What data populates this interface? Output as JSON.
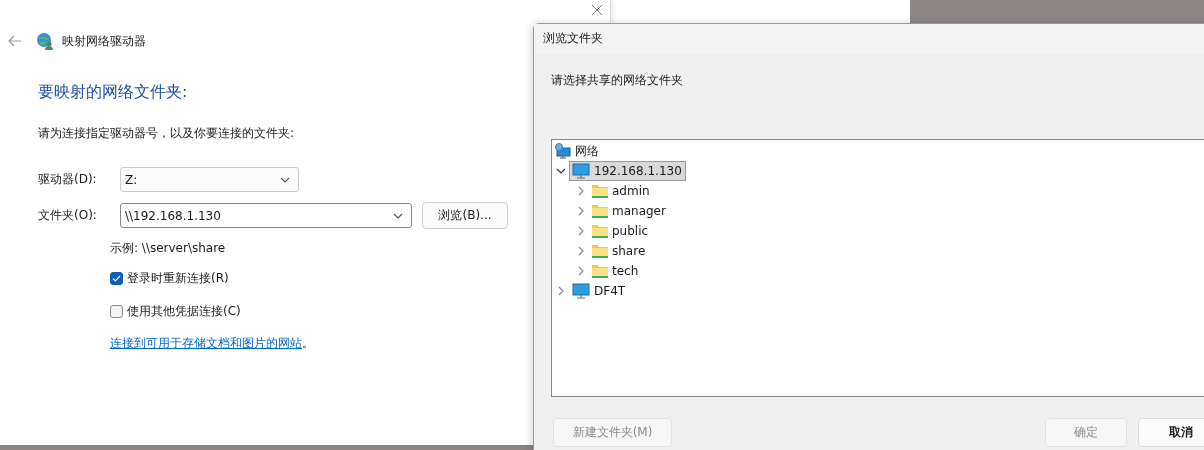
{
  "main_window": {
    "title": "映射网络驱动器",
    "heading": "要映射的网络文件夹:",
    "instruction": "请为连接指定驱动器号，以及你要连接的文件夹:",
    "drive": {
      "label": "驱动器(D):",
      "value": "Z:"
    },
    "folder": {
      "label": "文件夹(O):",
      "value": "\\\\192.168.1.130"
    },
    "browse_button": "浏览(B)...",
    "example": "示例: \\\\server\\share",
    "options": [
      {
        "label": "登录时重新连接(R)",
        "checked": true
      },
      {
        "label": "使用其他凭据连接(C)",
        "checked": false
      }
    ],
    "link": "连接到可用于存储文档和图片的网站",
    "link_suffix": "。"
  },
  "dialog": {
    "title": "浏览文件夹",
    "prompt": "请选择共享的网络文件夹",
    "tree": [
      {
        "label": "网络",
        "kind": "network",
        "selected": false,
        "children": [
          {
            "label": "192.168.1.130",
            "kind": "computer",
            "expanded": true,
            "selected": true,
            "children": [
              {
                "label": "admin",
                "kind": "folder",
                "expanded": false,
                "selected": false
              },
              {
                "label": "manager",
                "kind": "folder",
                "expanded": false,
                "selected": false
              },
              {
                "label": "public",
                "kind": "folder",
                "expanded": false,
                "selected": false
              },
              {
                "label": "share",
                "kind": "folder",
                "expanded": false,
                "selected": false
              },
              {
                "label": "tech",
                "kind": "folder",
                "expanded": false,
                "selected": false
              }
            ]
          },
          {
            "label": "DF4T",
            "kind": "computer",
            "expanded": false,
            "selected": false
          }
        ]
      }
    ],
    "buttons": [
      {
        "label": "新建文件夹(M)",
        "disabled": true
      },
      {
        "label": "确定",
        "disabled": true
      },
      {
        "label": "取消",
        "disabled": false
      }
    ]
  }
}
